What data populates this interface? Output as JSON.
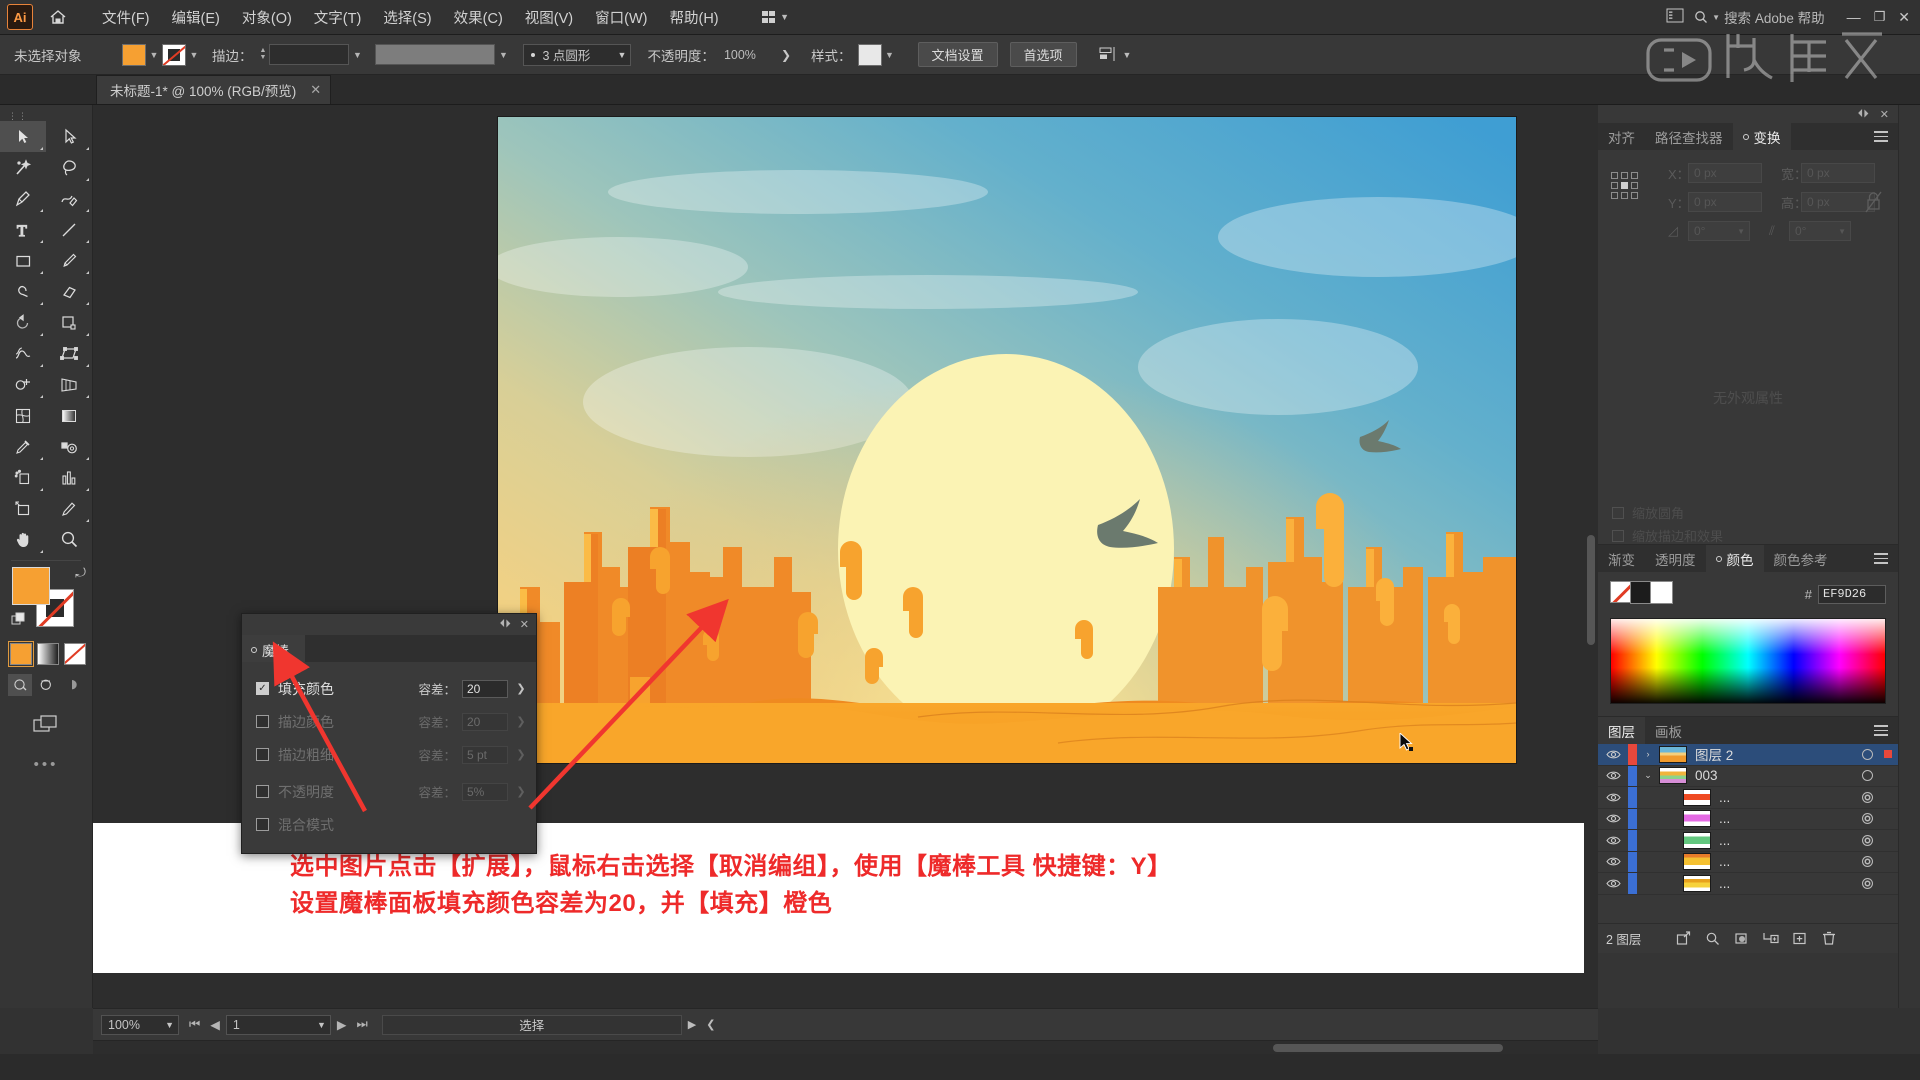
{
  "app": {
    "logo": "Ai",
    "home_icon": "home-icon",
    "workspace_label": "workspace-switcher"
  },
  "menubar": {
    "items": [
      {
        "label": "文件(F)"
      },
      {
        "label": "编辑(E)"
      },
      {
        "label": "对象(O)"
      },
      {
        "label": "文字(T)"
      },
      {
        "label": "选择(S)"
      },
      {
        "label": "效果(C)"
      },
      {
        "label": "视图(V)"
      },
      {
        "label": "窗口(W)"
      },
      {
        "label": "帮助(H)"
      }
    ],
    "search_placeholder": "搜索 Adobe 帮助",
    "minimize": "—",
    "maximize": "❐",
    "close": "✕"
  },
  "controlbar": {
    "no_selection_label": "未选择对象",
    "fill_color": "#F6A032",
    "stroke_color": "none",
    "stroke_label": "描边：",
    "stroke_weight": "",
    "stroke_profile": "",
    "brush_def": "",
    "brush_preview_color": "#7d7d7d",
    "opacity_label": "不透明度：",
    "opacity_value": "100%",
    "style_label": "样式：",
    "style_swatch": "#e8e8e8",
    "dot_profile": "3 点圆形",
    "doc_setup_btn": "文档设置",
    "preferences_btn": "首选项",
    "align_icon": "align-icon"
  },
  "document_tab": {
    "title": "未标题-1* @ 100% (RGB/预览)",
    "close": "✕"
  },
  "toolbar": {
    "tools": [
      {
        "name": "selection-tool",
        "selected": true
      },
      {
        "name": "direct-selection-tool",
        "selected": false
      },
      {
        "name": "magic-wand-tool",
        "selected": false
      },
      {
        "name": "lasso-tool",
        "selected": false
      },
      {
        "name": "pen-tool",
        "selected": false
      },
      {
        "name": "curvature-tool",
        "selected": false
      },
      {
        "name": "type-tool",
        "selected": false
      },
      {
        "name": "line-segment-tool",
        "selected": false
      },
      {
        "name": "rectangle-tool",
        "selected": false
      },
      {
        "name": "paintbrush-tool",
        "selected": false
      },
      {
        "name": "shaper-tool",
        "selected": false
      },
      {
        "name": "eraser-tool",
        "selected": false
      },
      {
        "name": "rotate-tool",
        "selected": false
      },
      {
        "name": "scale-tool",
        "selected": false
      },
      {
        "name": "width-tool",
        "selected": false
      },
      {
        "name": "free-transform-tool",
        "selected": false
      },
      {
        "name": "shape-builder-tool",
        "selected": false
      },
      {
        "name": "perspective-grid-tool",
        "selected": false
      },
      {
        "name": "mesh-tool",
        "selected": false
      },
      {
        "name": "gradient-tool",
        "selected": false
      },
      {
        "name": "eyedropper-tool",
        "selected": false
      },
      {
        "name": "blend-tool",
        "selected": false
      },
      {
        "name": "symbol-sprayer-tool",
        "selected": false
      },
      {
        "name": "column-graph-tool",
        "selected": false
      },
      {
        "name": "artboard-tool",
        "selected": false
      },
      {
        "name": "slice-tool",
        "selected": false
      },
      {
        "name": "hand-tool",
        "selected": false
      },
      {
        "name": "zoom-tool",
        "selected": false
      }
    ],
    "fill_color": "#F6A032",
    "stroke_color": "none",
    "color_modes": [
      "color-swatch",
      "gradient-swatch",
      "none-swatch"
    ],
    "draw_modes": [
      "draw-normal",
      "draw-behind",
      "draw-inside"
    ],
    "more_tools": "•••"
  },
  "magic_wand_panel": {
    "tab_label": "魔棒",
    "collapse": "⏴⏵",
    "close": "✕",
    "rows": [
      {
        "label": "填充颜色",
        "checked": true,
        "tol_label": "容差：",
        "tol_value": "20",
        "enabled": true
      },
      {
        "label": "描边颜色",
        "checked": false,
        "tol_label": "容差：",
        "tol_value": "20",
        "enabled": false
      },
      {
        "label": "描边粗细",
        "checked": false,
        "tol_label": "容差：",
        "tol_value": "5 pt",
        "enabled": false
      },
      {
        "label": "不透明度",
        "checked": false,
        "tol_label": "容差：",
        "tol_value": "5%",
        "enabled": false
      },
      {
        "label": "混合模式",
        "checked": false,
        "tol_label": "",
        "tol_value": "",
        "enabled": false
      }
    ]
  },
  "annotation": {
    "line1": "选中图片点击【扩展】，鼠标右击选择【取消编组】，使用【魔棒工具 快捷键：Y】",
    "line2": "设置魔棒面板填充颜色容差为20，并【填充】橙色",
    "color": "#EE2A2A"
  },
  "transform_panel": {
    "tabs": [
      {
        "label": "对齐",
        "active": false
      },
      {
        "label": "路径查找器",
        "active": false
      },
      {
        "label": "变换",
        "active": true
      }
    ],
    "collapse": "⏴⏵",
    "close": "✕",
    "menu": "panel-menu",
    "fields": [
      {
        "label": "X：",
        "value": "0 px"
      },
      {
        "label": "宽：",
        "value": "0 px"
      },
      {
        "label": "Y：",
        "value": "0 px"
      },
      {
        "label": "高：",
        "value": "0 px"
      }
    ],
    "angle_value": "0°",
    "shear_value": "0°",
    "scale_strokes_label": "缩放圆角",
    "scale_effects_label": "缩放描边和效果",
    "empty_text": "无外观属性"
  },
  "color_panel": {
    "tabs": [
      {
        "label": "渐变",
        "active": false
      },
      {
        "label": "透明度",
        "active": false
      },
      {
        "label": "颜色",
        "active": true
      },
      {
        "label": "颜色参考",
        "active": false
      }
    ],
    "hash": "#",
    "hex_value": "EF9D26",
    "fill_swatch": "#1c1c1c",
    "stroke_swatch": "#ffffff"
  },
  "layers_panel": {
    "tabs": [
      {
        "label": "图层",
        "active": true
      },
      {
        "label": "画板",
        "active": false
      }
    ],
    "rows": [
      {
        "name": "图层 2",
        "selected": true,
        "indent": 0,
        "has_arrow": true,
        "arrow": "›",
        "thumb_kind": "artwork",
        "color": "#e8483c"
      },
      {
        "name": "003",
        "selected": false,
        "indent": 1,
        "has_arrow": true,
        "arrow": "⌄",
        "thumb_kind": "group",
        "color": "#3b6fd4"
      },
      {
        "name": "...",
        "selected": false,
        "indent": 2,
        "has_arrow": false,
        "arrow": "",
        "thumb_kind": "red",
        "color": "#3b6fd4"
      },
      {
        "name": "...",
        "selected": false,
        "indent": 2,
        "has_arrow": false,
        "arrow": "",
        "thumb_kind": "magenta",
        "color": "#3b6fd4"
      },
      {
        "name": "...",
        "selected": false,
        "indent": 2,
        "has_arrow": false,
        "arrow": "",
        "thumb_kind": "green",
        "color": "#3b6fd4"
      },
      {
        "name": "...",
        "selected": false,
        "indent": 2,
        "has_arrow": false,
        "arrow": "",
        "thumb_kind": "orange",
        "color": "#3b6fd4"
      },
      {
        "name": "...",
        "selected": false,
        "indent": 2,
        "has_arrow": false,
        "arrow": "",
        "thumb_kind": "yellow",
        "color": "#3b6fd4"
      }
    ],
    "footer_count": "2 图层",
    "footer_icons": [
      "locate-object-icon",
      "search-icon",
      "make-clipping-mask-icon",
      "create-sublayer-icon",
      "create-new-layer-icon",
      "delete-layer-icon"
    ]
  },
  "statusbar": {
    "zoom_value": "100%",
    "page_value": "1",
    "status_text": "选择",
    "first_icon": "first-page-icon",
    "prev_icon": "prev-page-icon",
    "next_icon": "next-page-icon",
    "last_icon": "last-page-icon"
  },
  "artwork": {
    "title": "desert-sunset-illustration",
    "sky_top": "#4a9fd0",
    "sky_mid": "#8fc0c2",
    "sky_glow": "#f2d88a",
    "sun": "#fbf3b4",
    "dune_front": "#f79a24",
    "dune_mid": "#ea7a1c",
    "mesa_dark": "#c24a14",
    "cactus": "#f8a531"
  },
  "watermark": {
    "text": "虎课网"
  }
}
